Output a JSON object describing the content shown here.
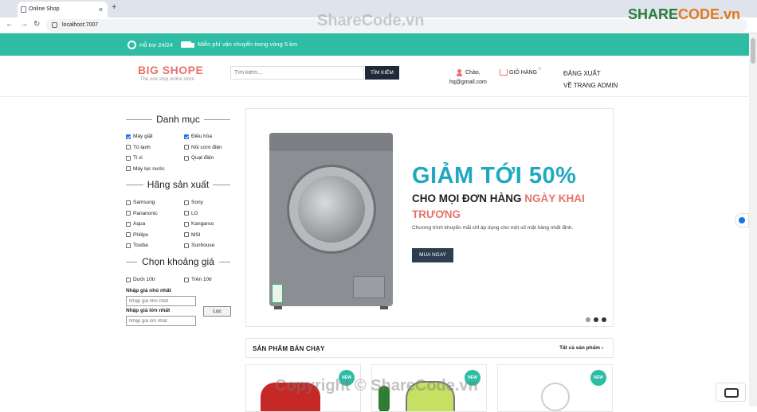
{
  "browser": {
    "tab_title": "Online Shop",
    "url": "localhost:7007"
  },
  "topbar": {
    "support": "Hỗ trợ 24/24",
    "shipping": "Miễn phí vận chuyển trong vòng 5 km"
  },
  "header": {
    "logo": "BIG SHOPE",
    "slogan": "The one stop online store",
    "search_placeholder": "Tìm kiếm...",
    "search_button": "TÌM KIẾM",
    "greeting": "Chào,",
    "email": "hq@gmail.com",
    "cart_label": "GIỎ HÀNG",
    "cart_count": "0",
    "logout": "ĐĂNG XUẤT",
    "admin": "VỀ TRANG ADMIN"
  },
  "sidebar": {
    "category_title": "Danh mục",
    "categories": [
      {
        "label": "Máy giặt",
        "checked": true
      },
      {
        "label": "Điều hòa",
        "checked": true
      },
      {
        "label": "Tủ lạnh",
        "checked": false
      },
      {
        "label": "Nồi cơm điện",
        "checked": false
      },
      {
        "label": "Ti vi",
        "checked": false
      },
      {
        "label": "Quạt điện",
        "checked": false
      },
      {
        "label": "Máy lọc nước",
        "checked": false
      }
    ],
    "brand_title": "Hãng sản xuất",
    "brands": [
      {
        "label": "Samsung",
        "checked": false
      },
      {
        "label": "Sony",
        "checked": false
      },
      {
        "label": "Pananonic",
        "checked": false
      },
      {
        "label": "LG",
        "checked": false
      },
      {
        "label": "Aqua",
        "checked": false
      },
      {
        "label": "Kangaroo",
        "checked": false
      },
      {
        "label": "Philips",
        "checked": false
      },
      {
        "label": "MSI",
        "checked": false
      },
      {
        "label": "Tosiba",
        "checked": false
      },
      {
        "label": "Sunhouse",
        "checked": false
      }
    ],
    "price_title": "Chọn khoảng giá",
    "price_ranges": [
      {
        "label": "Dưới 10tr",
        "checked": false
      },
      {
        "label": "Trên 10tr",
        "checked": false
      }
    ],
    "min_label": "Nhập giá nhỏ nhất",
    "min_placeholder": "Nhập giá nhỏ nhất",
    "max_label": "Nhập giá lớn nhất",
    "max_placeholder": "Nhập giá lớn nhất",
    "filter_button": "Lọc"
  },
  "banner": {
    "headline": "GIẢM TỚI 50%",
    "subline": "CHO MỌI ĐƠN HÀNG",
    "highlight": "NGÀY KHAI TRƯƠNG",
    "description": "Chương trình khuyến mãi chỉ áp dụng cho một số mặt hàng nhất định.",
    "button": "MUA NGAY",
    "active_slide": 2
  },
  "best_sellers": {
    "title": "SẢN PHẨM BÁN CHẠY",
    "view_all": "Tất cả sản phẩm",
    "badges": [
      "NEW",
      "NEW",
      "NEW"
    ]
  },
  "watermark": {
    "logo_a": "SHARE",
    "logo_b": "CODE.vn",
    "top": "ShareCode.vn",
    "bottom": "Copyright © ShareCode.vn"
  },
  "colors": {
    "accent": "#2ebda4",
    "brand": "#e8736a",
    "headline": "#1fa9c1",
    "dark": "#1f2937"
  }
}
